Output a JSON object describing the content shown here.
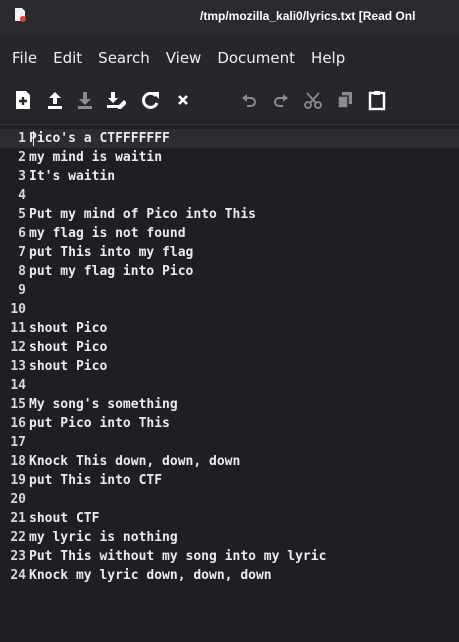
{
  "window": {
    "title": "/tmp/mozilla_kali0/lyrics.txt [Read Onl"
  },
  "menu": {
    "items": [
      "File",
      "Edit",
      "Search",
      "View",
      "Document",
      "Help"
    ]
  },
  "toolbar": {
    "buttons": [
      {
        "name": "new-document-icon"
      },
      {
        "name": "open-file-icon"
      },
      {
        "name": "save-file-icon"
      },
      {
        "name": "save-as-icon"
      },
      {
        "name": "reload-icon"
      },
      {
        "name": "close-icon"
      },
      {
        "name": "undo-icon"
      },
      {
        "name": "redo-icon"
      },
      {
        "name": "cut-icon"
      },
      {
        "name": "copy-icon"
      },
      {
        "name": "paste-icon"
      }
    ]
  },
  "editor": {
    "current_line": 1,
    "lines": [
      {
        "n": "1",
        "t": "Pico's a CTFFFFFFF"
      },
      {
        "n": "2",
        "t": "my mind is waitin"
      },
      {
        "n": "3",
        "t": "It's waitin"
      },
      {
        "n": "4",
        "t": ""
      },
      {
        "n": "5",
        "t": "Put my mind of Pico into This"
      },
      {
        "n": "6",
        "t": "my flag is not found"
      },
      {
        "n": "7",
        "t": "put This into my flag"
      },
      {
        "n": "8",
        "t": "put my flag into Pico"
      },
      {
        "n": "9",
        "t": ""
      },
      {
        "n": "10",
        "t": ""
      },
      {
        "n": "11",
        "t": "shout Pico"
      },
      {
        "n": "12",
        "t": "shout Pico"
      },
      {
        "n": "13",
        "t": "shout Pico"
      },
      {
        "n": "14",
        "t": ""
      },
      {
        "n": "15",
        "t": "My song's something"
      },
      {
        "n": "16",
        "t": "put Pico into This"
      },
      {
        "n": "17",
        "t": ""
      },
      {
        "n": "18",
        "t": "Knock This down, down, down"
      },
      {
        "n": "19",
        "t": "put This into CTF"
      },
      {
        "n": "20",
        "t": ""
      },
      {
        "n": "21",
        "t": "shout CTF"
      },
      {
        "n": "22",
        "t": "my lyric is nothing"
      },
      {
        "n": "23",
        "t": "Put This without my song into my lyric"
      },
      {
        "n": "24",
        "t": "Knock my lyric down, down, down"
      }
    ]
  }
}
